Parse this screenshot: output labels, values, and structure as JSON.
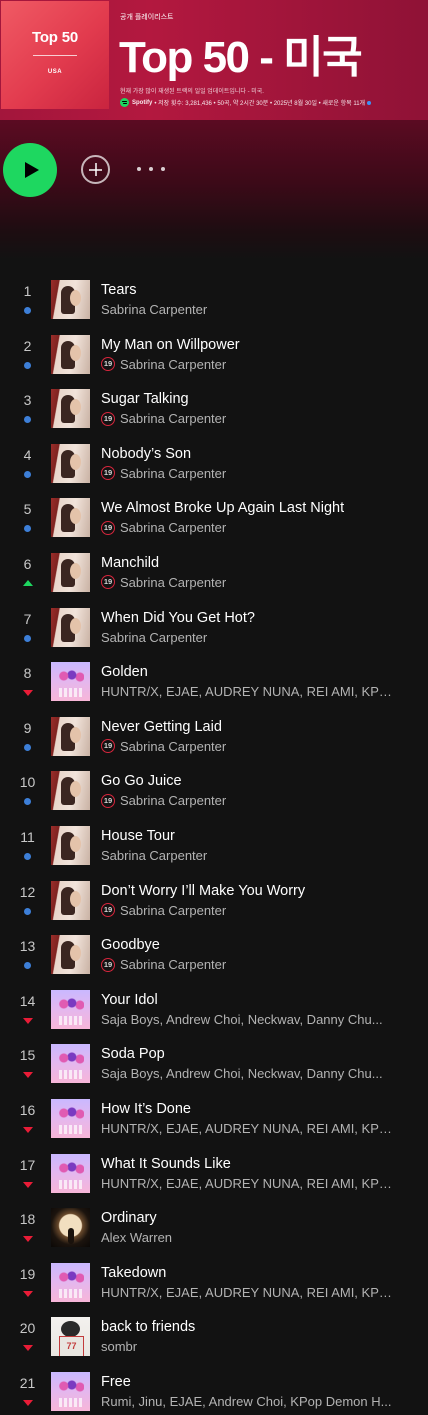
{
  "header": {
    "cover_title": "Top 50",
    "cover_sub": "USA",
    "playlist_type": "공개 플레이리스트",
    "title": "Top 50 - 미국",
    "description": "현재 가장 많이 재생된 트랙의 일일 업데이트입니다 - 미국.",
    "brand": "Spotify",
    "meta": "• 저장 횟수: 3,281,436 • 50곡, 약 2시간 30분 • 2025년 8월 30일 • 새로운 항목 11개"
  },
  "colors": {
    "accent": "#1ed760",
    "header": "#a3163c",
    "explicit_ring": "#d7263d",
    "down": "#e91c37",
    "same": "#3d7fd8"
  },
  "tracks": [
    {
      "num": "1",
      "title": "Tears",
      "artist": "Sabrina Carpenter",
      "explicit": false,
      "trend": "same",
      "art": "sab"
    },
    {
      "num": "2",
      "title": "My Man on Willpower",
      "artist": "Sabrina Carpenter",
      "explicit": true,
      "trend": "same",
      "art": "sab"
    },
    {
      "num": "3",
      "title": "Sugar Talking",
      "artist": "Sabrina Carpenter",
      "explicit": true,
      "trend": "same",
      "art": "sab"
    },
    {
      "num": "4",
      "title": "Nobody’s Son",
      "artist": "Sabrina Carpenter",
      "explicit": true,
      "trend": "same",
      "art": "sab"
    },
    {
      "num": "5",
      "title": "We Almost Broke Up Again Last Night",
      "artist": "Sabrina Carpenter",
      "explicit": true,
      "trend": "same",
      "art": "sab"
    },
    {
      "num": "6",
      "title": "Manchild",
      "artist": "Sabrina Carpenter",
      "explicit": true,
      "trend": "up",
      "art": "sab"
    },
    {
      "num": "7",
      "title": "When Did You Get Hot?",
      "artist": "Sabrina Carpenter",
      "explicit": false,
      "trend": "same",
      "art": "sab"
    },
    {
      "num": "8",
      "title": "Golden",
      "artist": "HUNTR/X, EJAE, AUDREY NUNA, REI AMI, KPo...",
      "explicit": false,
      "trend": "down",
      "art": "kpop"
    },
    {
      "num": "9",
      "title": "Never Getting Laid",
      "artist": "Sabrina Carpenter",
      "explicit": true,
      "trend": "same",
      "art": "sab"
    },
    {
      "num": "10",
      "title": "Go Go Juice",
      "artist": "Sabrina Carpenter",
      "explicit": true,
      "trend": "same",
      "art": "sab"
    },
    {
      "num": "11",
      "title": "House Tour",
      "artist": "Sabrina Carpenter",
      "explicit": false,
      "trend": "same",
      "art": "sab"
    },
    {
      "num": "12",
      "title": "Don’t Worry I’ll Make You Worry",
      "artist": "Sabrina Carpenter",
      "explicit": true,
      "trend": "same",
      "art": "sab"
    },
    {
      "num": "13",
      "title": "Goodbye",
      "artist": "Sabrina Carpenter",
      "explicit": true,
      "trend": "same",
      "art": "sab"
    },
    {
      "num": "14",
      "title": "Your Idol",
      "artist": "Saja Boys, Andrew Choi, Neckwav, Danny Chu...",
      "explicit": false,
      "trend": "down",
      "art": "kpop"
    },
    {
      "num": "15",
      "title": "Soda Pop",
      "artist": "Saja Boys, Andrew Choi, Neckwav, Danny Chu...",
      "explicit": false,
      "trend": "down",
      "art": "kpop"
    },
    {
      "num": "16",
      "title": "How It’s Done",
      "artist": "HUNTR/X, EJAE, AUDREY NUNA, REI AMI, KPo...",
      "explicit": false,
      "trend": "down",
      "art": "kpop"
    },
    {
      "num": "17",
      "title": "What It Sounds Like",
      "artist": "HUNTR/X, EJAE, AUDREY NUNA, REI AMI, KPo...",
      "explicit": false,
      "trend": "down",
      "art": "kpop"
    },
    {
      "num": "18",
      "title": "Ordinary",
      "artist": "Alex Warren",
      "explicit": false,
      "trend": "down",
      "art": "alex"
    },
    {
      "num": "19",
      "title": "Takedown",
      "artist": "HUNTR/X, EJAE, AUDREY NUNA, REI AMI, KPo...",
      "explicit": false,
      "trend": "down",
      "art": "kpop"
    },
    {
      "num": "20",
      "title": "back to friends",
      "artist": "sombr",
      "explicit": false,
      "trend": "down",
      "art": "sombr"
    },
    {
      "num": "21",
      "title": "Free",
      "artist": "Rumi, Jinu, EJAE, Andrew Choi, KPop Demon H...",
      "explicit": false,
      "trend": "down",
      "art": "kpop"
    }
  ],
  "explicit_label": "19"
}
